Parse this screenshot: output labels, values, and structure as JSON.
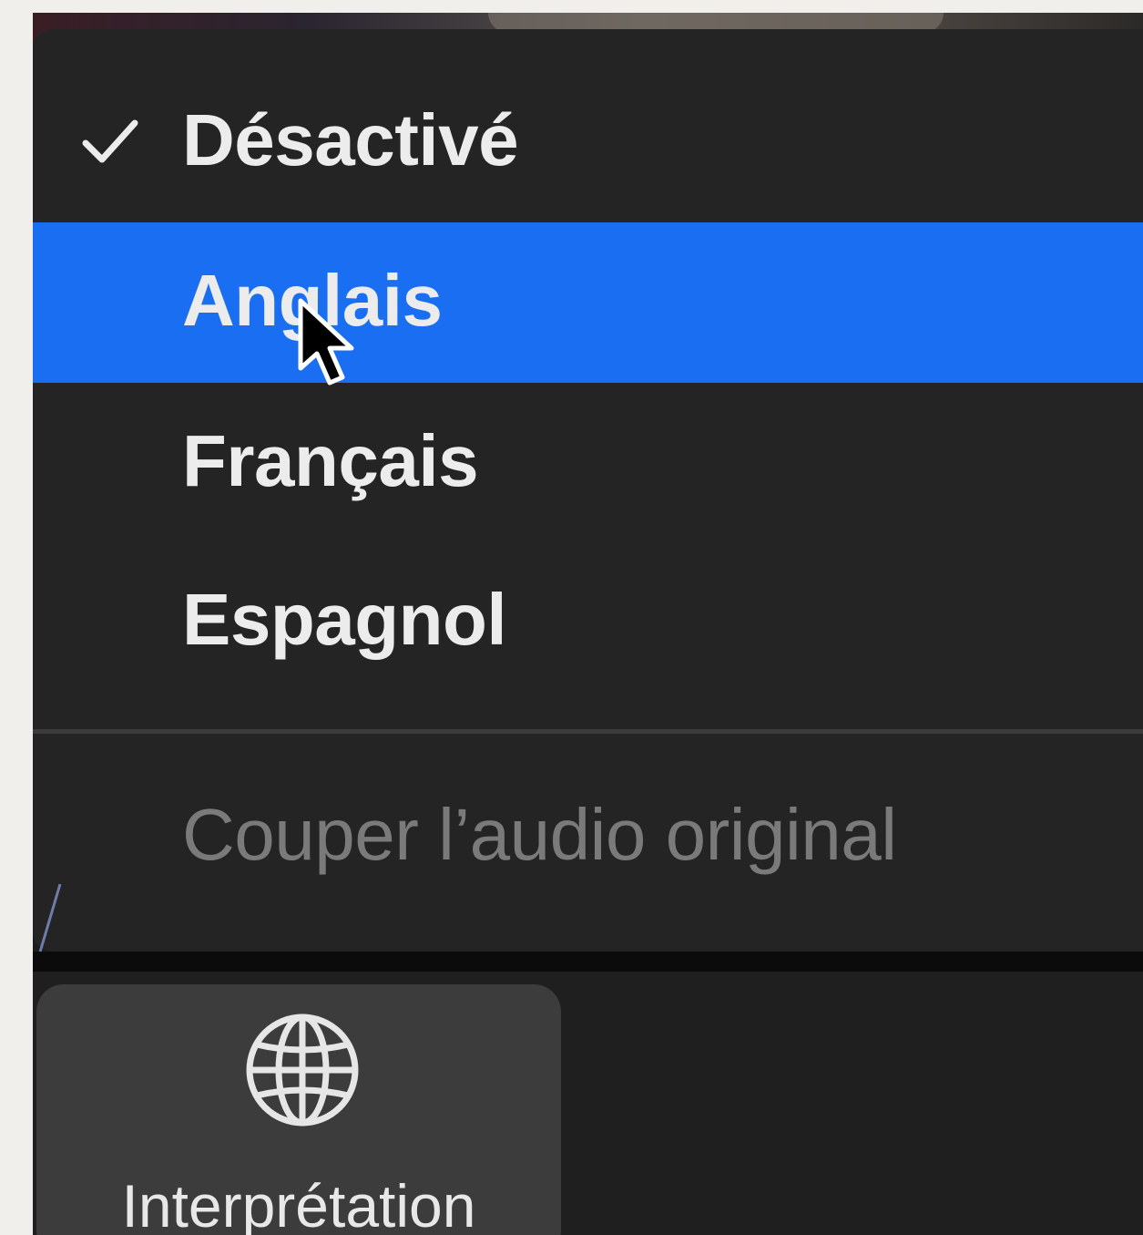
{
  "interpretation_menu": {
    "items": [
      {
        "label": "Désactivé",
        "checked": true,
        "highlighted": false,
        "enabled": true
      },
      {
        "label": "Anglais",
        "checked": false,
        "highlighted": true,
        "enabled": true
      },
      {
        "label": "Français",
        "checked": false,
        "highlighted": false,
        "enabled": true
      },
      {
        "label": "Espagnol",
        "checked": false,
        "highlighted": false,
        "enabled": true
      }
    ],
    "mute_original": {
      "label": "Couper l’audio original",
      "enabled": false
    }
  },
  "toolbar": {
    "interpretation_button": {
      "label": "Interprétation",
      "icon": "globe-icon"
    }
  },
  "colors": {
    "menu_background": "#242424",
    "highlight": "#1a6ef2",
    "text": "#ececec",
    "disabled_text": "#7a7a7a",
    "toolbar_button": "#3c3c3c"
  }
}
